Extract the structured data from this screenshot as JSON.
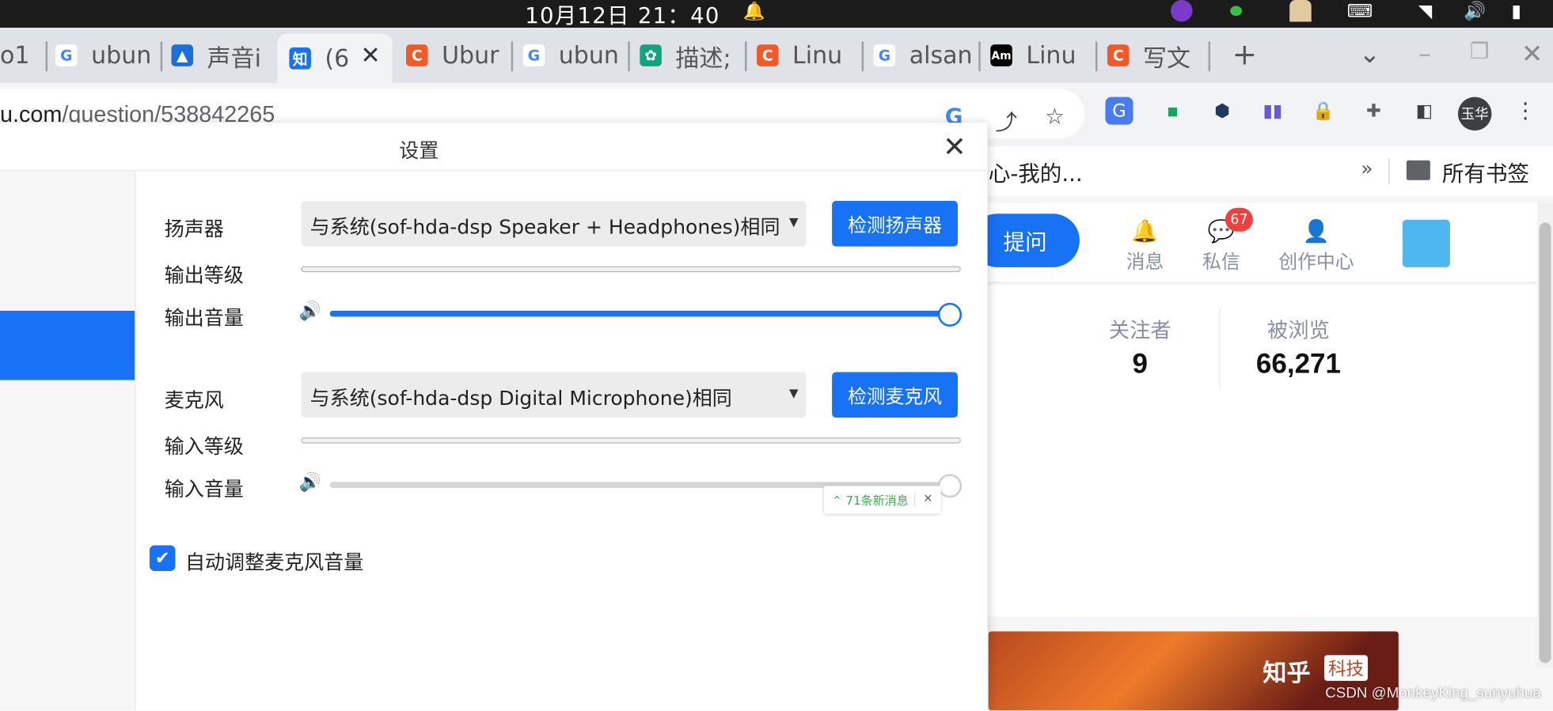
{
  "system_bar": {
    "clock": "10月12日  21：40"
  },
  "tabs": [
    {
      "label": "o1",
      "icon": "partial-tab"
    },
    {
      "label": "ubun",
      "icon": "google-icon"
    },
    {
      "label": "声音i",
      "icon": "chart-app-icon"
    },
    {
      "label": "(6",
      "icon": "zhihu-icon",
      "active": true
    },
    {
      "label": "Ubur",
      "icon": "csdn-icon"
    },
    {
      "label": "ubun",
      "icon": "google-icon"
    },
    {
      "label": "描述;",
      "icon": "chatgpt-icon"
    },
    {
      "label": "Linu",
      "icon": "csdn-icon"
    },
    {
      "label": "alsan",
      "icon": "google-icon"
    },
    {
      "label": "Linu",
      "icon": "am-icon"
    },
    {
      "label": "写文",
      "icon": "csdn-icon"
    }
  ],
  "address_bar": {
    "url_prefix": "u.com",
    "url_path": "/question/538842265"
  },
  "profile": {
    "avatar_text": "玉华"
  },
  "bookmarks": {
    "partial_text": "心-我的...",
    "more": "»",
    "all_bookmarks": "所有书签"
  },
  "zhihu": {
    "ask_label": "提问",
    "nav": [
      {
        "label": "消息"
      },
      {
        "label": "私信"
      },
      {
        "label": "创作中心"
      }
    ],
    "unread_badge": "67",
    "followers_label": "关注者",
    "followers_value": "9",
    "views_label": "被浏览",
    "views_value": "66,271",
    "banner_text": "知乎",
    "banner_tag": "科技"
  },
  "watermark": "CSDN @MonkeyKing_sunyuhua",
  "dialog": {
    "title": "设置",
    "speaker_label": "扬声器",
    "speaker_value": "与系统(sof-hda-dsp Speaker + Headphones)相同",
    "test_speaker": "检测扬声器",
    "output_level_label": "输出等级",
    "output_volume_label": "输出音量",
    "output_volume": 1.0,
    "mic_label": "麦克风",
    "mic_value": "与系统(sof-hda-dsp Digital Microphone)相同",
    "test_mic": "检测麦克风",
    "input_level_label": "输入等级",
    "input_volume_label": "输入音量",
    "input_volume": 1.0,
    "auto_adjust_label": "自动调整麦克风音量",
    "auto_adjust_checked": true,
    "toast_text": "71条新消息",
    "toast_close": "×"
  },
  "colors": {
    "accent": "#1772f6",
    "badge": "#f1403c"
  }
}
